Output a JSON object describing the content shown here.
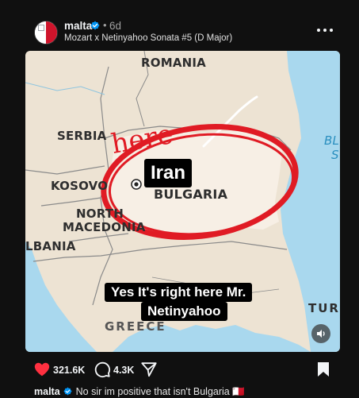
{
  "post": {
    "username": "malta",
    "time": "6d",
    "dot": "•",
    "audio": "Mozart x Netinyahoo Sonata #5 (D Major)",
    "more_icon": "more-horizontal-icon"
  },
  "map": {
    "labels": {
      "romania": "ROMANIA",
      "serbia": "SERBIA",
      "kosovo": "KOSOVO",
      "north": "NORTH",
      "macedonia": "MACEDONIA",
      "albania": "LBANIA",
      "bulgaria": "BULGARIA",
      "greece": "GREECE",
      "turkey": "TUR",
      "black_sea_1": "BL",
      "black_sea_2": "S"
    },
    "annotation_here": "here",
    "overlay_label": "Iran",
    "subtitle_line1": "Yes It's right here Mr.",
    "subtitle_line2": "Netinyahoo",
    "colors": {
      "land": "#ede3d3",
      "bulgaria_land": "#f7efe5",
      "sea": "#a9d8ee",
      "circle": "#e01b24",
      "border": "#8a8a8a"
    }
  },
  "actions": {
    "likes": "321.6K",
    "comments": "4.3K",
    "like_color": "#ff3040"
  },
  "caption": {
    "username": "malta",
    "text": "No sir im positive that isn't Bulgaria 🇲🇹"
  }
}
